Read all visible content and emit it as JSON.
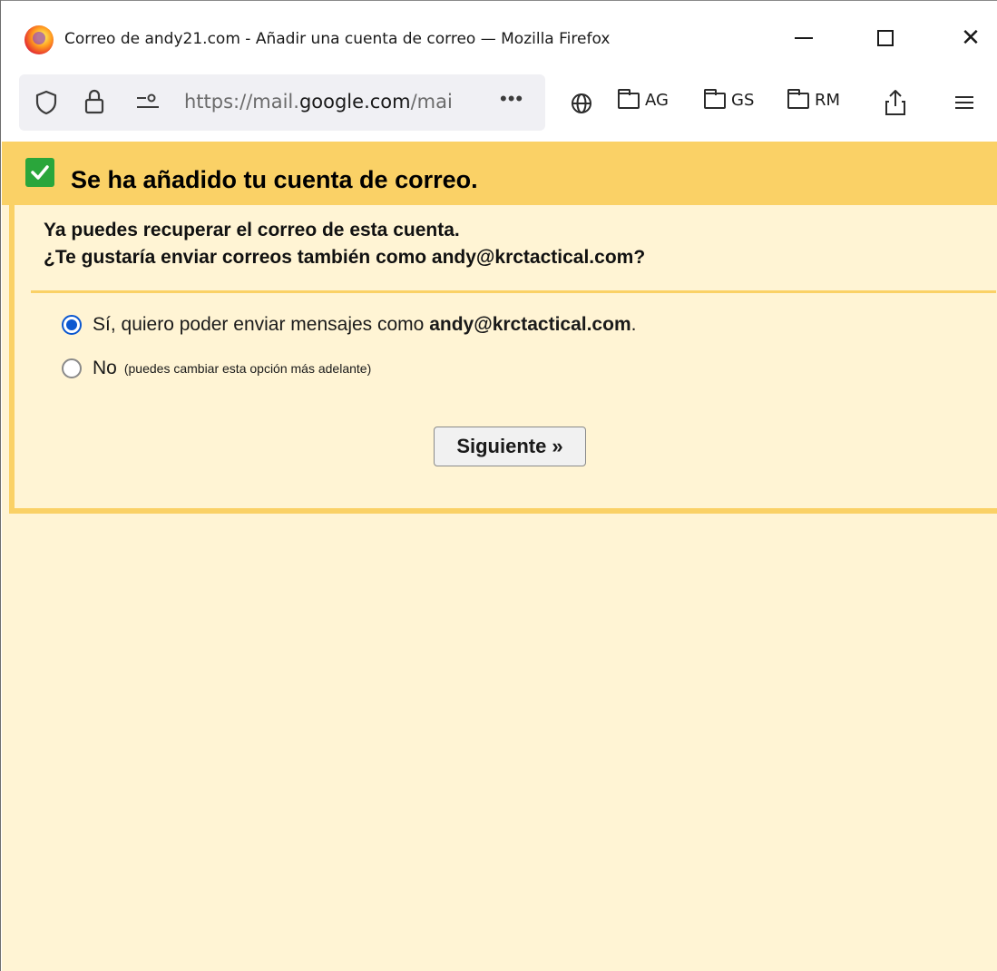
{
  "window": {
    "title": "Correo de andy21.com - Añadir una cuenta de correo — Mozilla Firefox"
  },
  "urlbar": {
    "url_prefix": "https://mail.",
    "url_domain": "google.com",
    "url_suffix": "/mai",
    "more": "•••"
  },
  "bookmarks": [
    {
      "label": "AG"
    },
    {
      "label": "GS"
    },
    {
      "label": "RM"
    }
  ],
  "banner": {
    "title": "Se ha añadido tu cuenta de correo."
  },
  "intro": {
    "line1": "Ya puedes recuperar el correo de esta cuenta.",
    "line2": "¿Te gustaría enviar correos también como andy@krctactical.com?"
  },
  "options": {
    "yes_prefix": "Sí, quiero poder enviar mensajes como ",
    "yes_email": "andy@krctactical.com",
    "yes_suffix": ".",
    "no_label": "No",
    "no_hint": "(puedes cambiar esta opción más adelante)",
    "selected": "yes"
  },
  "buttons": {
    "next_label": "Siguiente »"
  },
  "colors": {
    "banner": "#fad166",
    "background": "#fff4d4",
    "check": "#2aa63b",
    "radio_selected": "#0b57d0"
  }
}
